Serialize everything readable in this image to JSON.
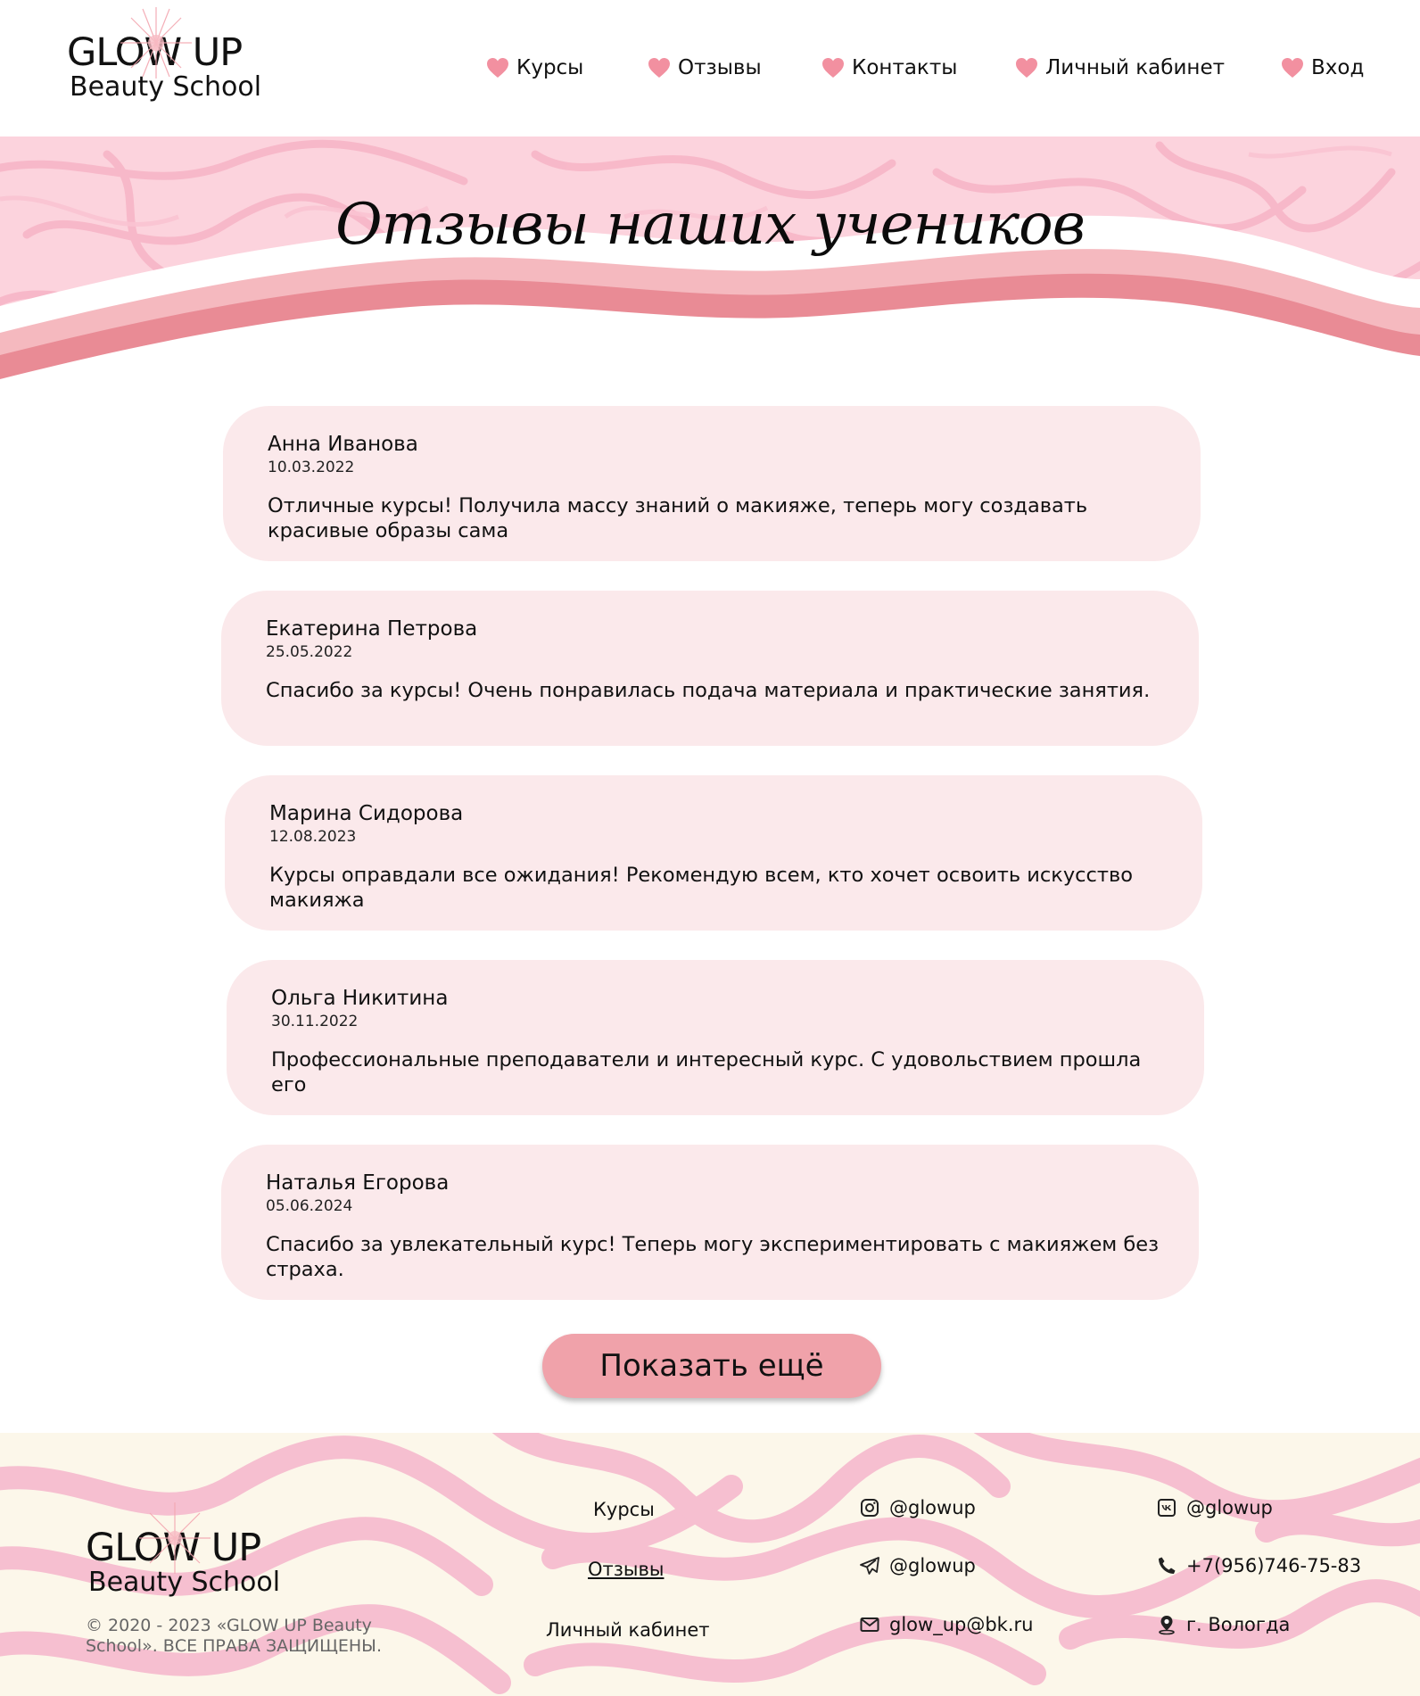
{
  "brand": {
    "title": "GLOW UP",
    "subtitle": "Beauty School"
  },
  "nav": {
    "items": [
      {
        "label": "Курсы"
      },
      {
        "label": "Отзывы"
      },
      {
        "label": "Контакты"
      },
      {
        "label": "Личный кабинет"
      },
      {
        "label": "Вход"
      }
    ]
  },
  "hero": {
    "title": "Отзывы наших учеников"
  },
  "reviews": [
    {
      "name": "Анна Иванова",
      "date": "10.03.2022",
      "text": "Отличные курсы! Получила массу знаний о макияже, теперь могу создавать красивые образы сама"
    },
    {
      "name": "Екатерина Петрова",
      "date": "25.05.2022",
      "text": "Спасибо за курсы! Очень понравилась подача материала и практические занятия."
    },
    {
      "name": "Марина Сидорова",
      "date": "12.08.2023",
      "text": "Курсы оправдали все ожидания! Рекомендую всем, кто хочет освоить искусство макияжа"
    },
    {
      "name": "Ольга Никитина",
      "date": "30.11.2022",
      "text": "Профессиональные преподаватели и интересный курс. С удовольствием прошла его"
    },
    {
      "name": "Наталья Егорова",
      "date": "05.06.2024",
      "text": "Спасибо за увлекательный курс! Теперь могу экспериментировать с макияжем без страха."
    }
  ],
  "more_button": {
    "label": "Показать ещё"
  },
  "footer": {
    "copyright": "© 2020 - 2023 «GLOW UP Beauty School». ВСЕ ПРАВА ЗАЩИЩЕНЫ.",
    "links": [
      {
        "label": "Курсы"
      },
      {
        "label": "Отзывы"
      },
      {
        "label": "Личный кабинет"
      }
    ],
    "contacts": {
      "instagram": "@glowup",
      "telegram": "@glowup",
      "email": "glow_up@bk.ru",
      "vk": "@glowup",
      "phone": "+7(956)746-75-83",
      "city": "г. Вологда"
    }
  },
  "colors": {
    "accent_pink": "#f0a2aa",
    "card_bg": "#fbe9eb",
    "wave_light": "#f5b9bf",
    "wave_dark": "#e98b95",
    "pattern_bg": "#fcd3dd",
    "footer_bg": "#fcf7ea"
  },
  "icons": [
    "heart-icon",
    "instagram-icon",
    "telegram-icon",
    "mail-icon",
    "vk-icon",
    "phone-icon",
    "location-icon"
  ]
}
